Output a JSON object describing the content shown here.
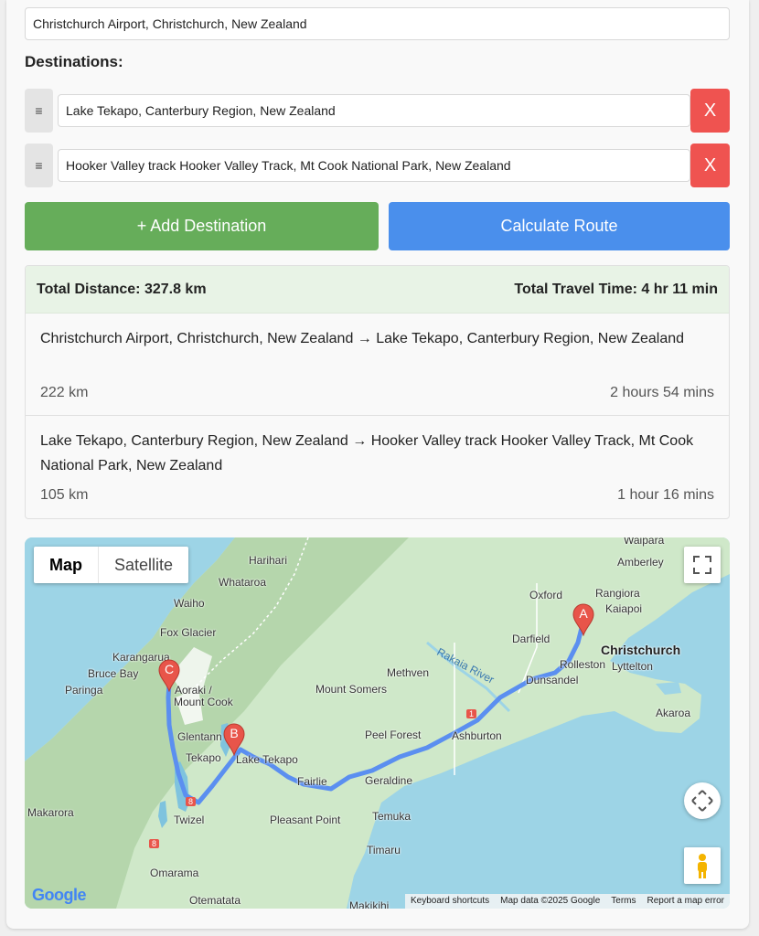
{
  "origin": {
    "value": "Christchurch Airport, Christchurch, New Zealand"
  },
  "destinations": {
    "title": "Destinations:",
    "handle_glyph": "≡",
    "remove_label": "X",
    "items": [
      {
        "value": "Lake Tekapo, Canterbury Region, New Zealand"
      },
      {
        "value": "Hooker Valley track Hooker Valley Track, Mt Cook National Park, New Zealand"
      }
    ]
  },
  "buttons": {
    "add": "+ Add Destination",
    "calculate": "Calculate Route"
  },
  "summary": {
    "distance": "Total Distance: 327.8 km",
    "time": "Total Travel Time: 4 hr 11 min"
  },
  "legs": [
    {
      "route": "Christchurch Airport, Christchurch, New Zealand → Lake Tekapo, Canterbury Region, New Zealand",
      "distance": "222 km",
      "duration": "2 hours 54 mins"
    },
    {
      "route": "Lake Tekapo, Canterbury Region, New Zealand → Hooker Valley track Hooker Valley Track, Mt Cook National Park, New Zealand",
      "distance": "105 km",
      "duration": "1 hour 16 mins"
    }
  ],
  "map": {
    "type_buttons": {
      "map": "Map",
      "satellite": "Satellite"
    },
    "markers": {
      "a": "A",
      "b": "B",
      "c": "C"
    },
    "places": {
      "waipara": "Waipara",
      "amberley": "Amberley",
      "harihari": "Harihari",
      "whataroa": "Whataroa",
      "oxford": "Oxford",
      "rangiora": "Rangiora",
      "kaiapoi": "Kaiapoi",
      "waiho": "Waiho",
      "fox_glacier": "Fox Glacier",
      "darfield": "Darfield",
      "christchurch": "Christchurch",
      "karangarua": "Karangarua",
      "rolleston": "Rolleston",
      "lyttelton": "Lyttelton",
      "bruce_bay": "Bruce Bay",
      "methven": "Methven",
      "paringa": "Paringa",
      "aoraki": "Aoraki /",
      "mount_cook": "Mount Cook",
      "mount_somers": "Mount Somers",
      "dunsandel": "Dunsandel",
      "rakaia_river": "Rakaia River",
      "akaroa": "Akaroa",
      "glentanner": "Glentann",
      "peel_forest": "Peel Forest",
      "ashburton": "Ashburton",
      "tekapo": "Tekapo",
      "lake_tekapo": "Lake Tekapo",
      "fairlie": "Fairlie",
      "geraldine": "Geraldine",
      "makarora": "Makarora",
      "twizel": "Twizel",
      "pleasant_point": "Pleasant Point",
      "temuka": "Temuka",
      "timaru": "Timaru",
      "omarama": "Omarama",
      "otematata": "Otematata",
      "makikihi": "Makikihi"
    },
    "road_shields": {
      "sh1": "1",
      "sh8": "8",
      "sh80": "8"
    },
    "logo": "Google",
    "attribution": {
      "shortcuts": "Keyboard shortcuts",
      "data": "Map data ©2025 Google",
      "terms": "Terms",
      "report": "Report a map error"
    },
    "colors": {
      "water": "#9dd4e6",
      "land": "#cfe8c9",
      "mountains": "#b5d6ac",
      "route": "#5b8ff0",
      "marker": "#e8554a"
    }
  }
}
